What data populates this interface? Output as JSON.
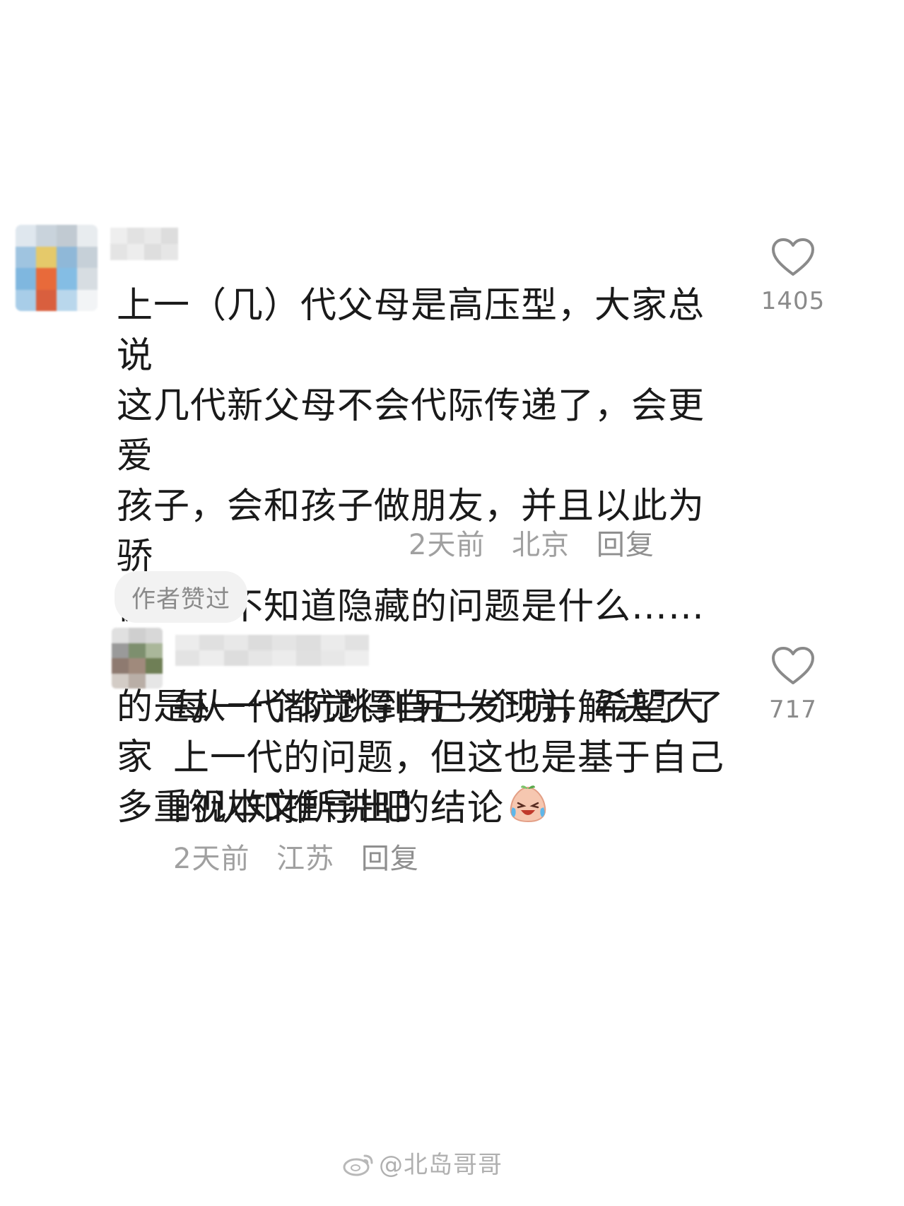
{
  "comments": [
    {
      "text": "上一（几）代父母是高压型，大家总说\n这几代新父母不会代际传递了，会更爱\n孩子，会和孩子做朋友，并且以此为骄\n傲，且不知道隐藏的问题是什么……真\n的是从一个坑跳到另一个坑，希望大家\n多重视本文所讲吧",
      "time": "2天前",
      "location": "北京",
      "reply": "回复",
      "badge": "作者赞过",
      "likes": "1405",
      "like_icon": "heart-icon"
    },
    {
      "text": "每一代都觉得自己发现并解决了了\n上一代的问题，但这也是基于自己\n的认知推导出的结论",
      "emoji": "crying-laughing-peach-emoji",
      "time": "2天前",
      "location": "江苏",
      "reply": "回复",
      "likes": "717",
      "like_icon": "heart-icon"
    }
  ],
  "watermark": "@北岛哥哥"
}
